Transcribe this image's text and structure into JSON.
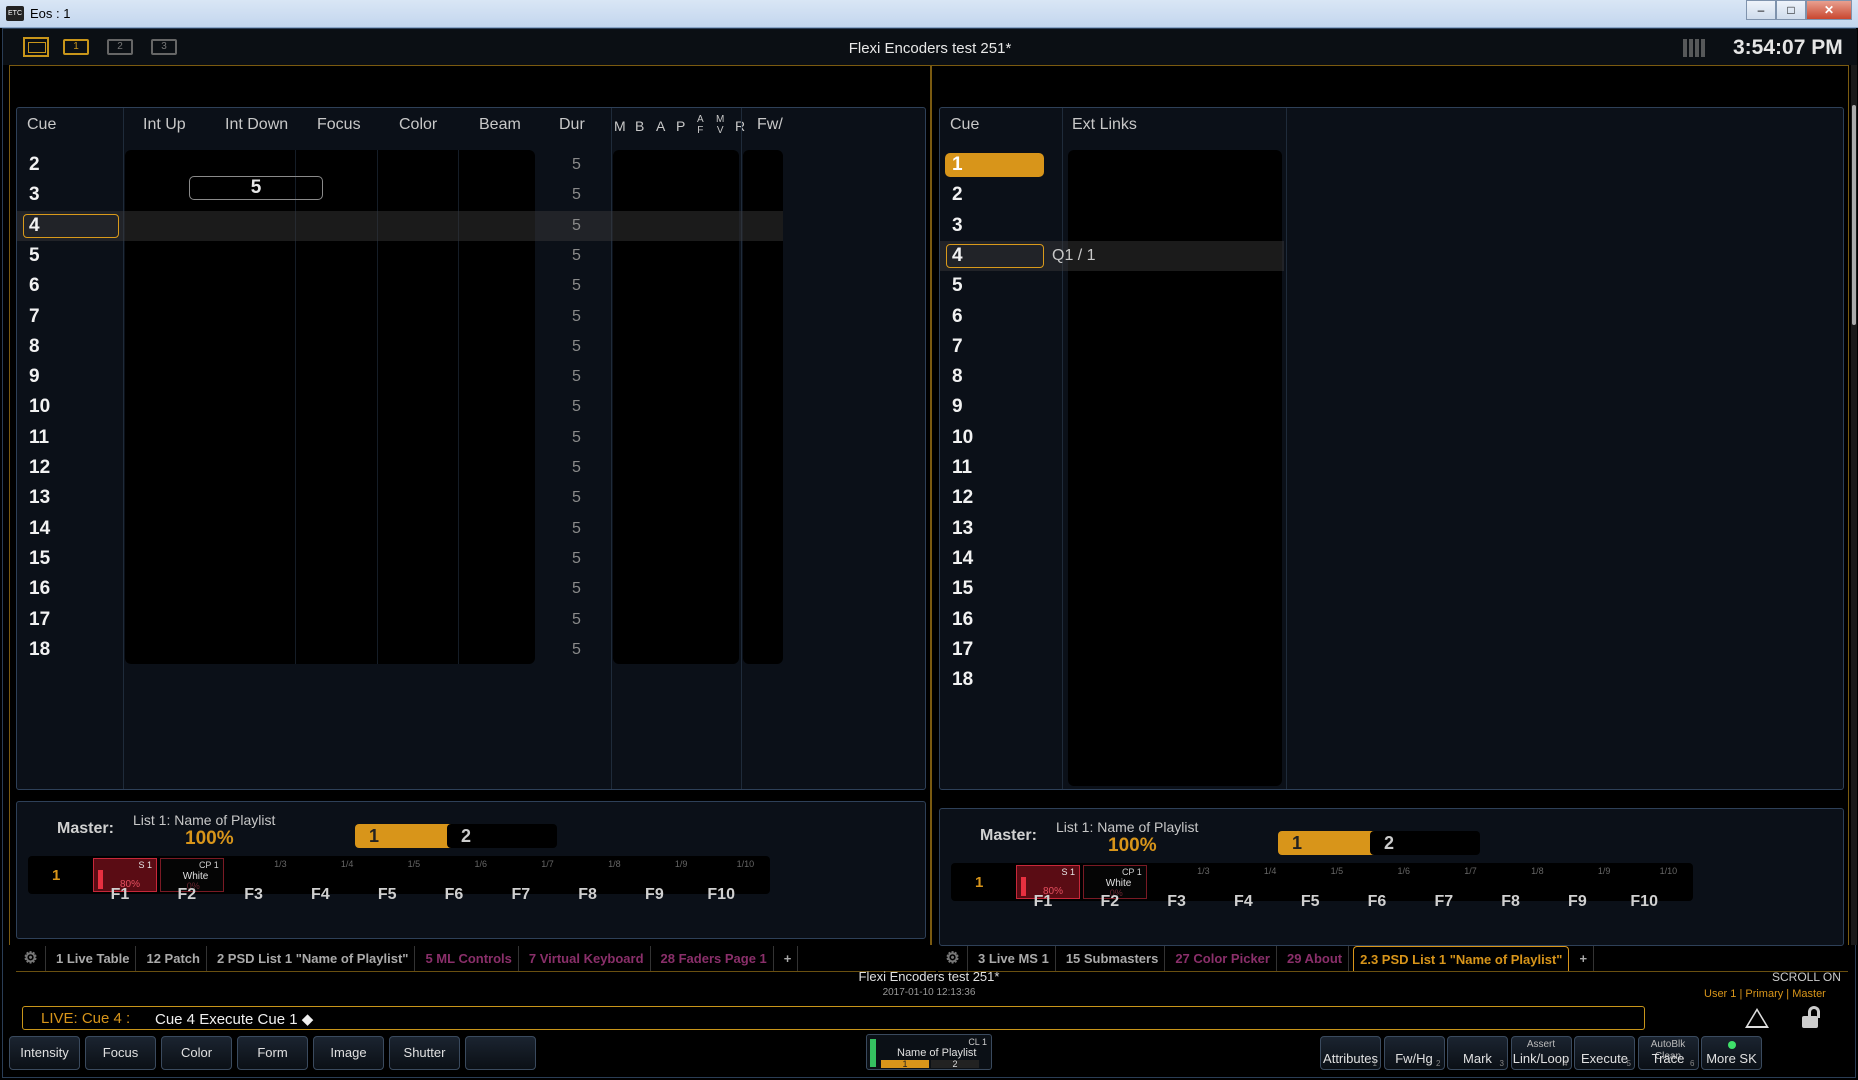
{
  "window": {
    "title": "Eos : 1",
    "icon_text": "ETC"
  },
  "topbar": {
    "workspaces": [
      "1",
      "2",
      "3"
    ],
    "show_title": "Flexi Encoders test 251*",
    "clock": "3:54:07 PM"
  },
  "left_cuelist": {
    "headers": {
      "cue": "Cue",
      "int_up": "Int Up",
      "int_down": "Int Down",
      "focus": "Focus",
      "color": "Color",
      "beam": "Beam",
      "dur": "Dur",
      "m": "M",
      "b": "B",
      "a": "A",
      "p": "P",
      "af_a": "A",
      "af_f": "F",
      "mv_m": "M",
      "mv_v": "V",
      "r": "R",
      "fw": "Fw/"
    },
    "int_up_value": "5",
    "selected_cue": "4",
    "rows": [
      {
        "cue": "2",
        "dur": "5"
      },
      {
        "cue": "3",
        "dur": "5"
      },
      {
        "cue": "4",
        "dur": "5"
      },
      {
        "cue": "5",
        "dur": "5"
      },
      {
        "cue": "6",
        "dur": "5"
      },
      {
        "cue": "7",
        "dur": "5"
      },
      {
        "cue": "8",
        "dur": "5"
      },
      {
        "cue": "9",
        "dur": "5"
      },
      {
        "cue": "10",
        "dur": "5"
      },
      {
        "cue": "11",
        "dur": "5"
      },
      {
        "cue": "12",
        "dur": "5"
      },
      {
        "cue": "13",
        "dur": "5"
      },
      {
        "cue": "14",
        "dur": "5"
      },
      {
        "cue": "15",
        "dur": "5"
      },
      {
        "cue": "16",
        "dur": "5"
      },
      {
        "cue": "17",
        "dur": "5"
      },
      {
        "cue": "18",
        "dur": "5"
      }
    ]
  },
  "right_cuelist": {
    "headers": {
      "cue": "Cue",
      "ext_links": "Ext Links"
    },
    "active_cue": "1",
    "selected_cue": "4",
    "rows": [
      {
        "cue": "1",
        "ext": ""
      },
      {
        "cue": "2",
        "ext": ""
      },
      {
        "cue": "3",
        "ext": ""
      },
      {
        "cue": "4",
        "ext": "Q1 / 1"
      },
      {
        "cue": "5",
        "ext": ""
      },
      {
        "cue": "6",
        "ext": ""
      },
      {
        "cue": "7",
        "ext": ""
      },
      {
        "cue": "8",
        "ext": ""
      },
      {
        "cue": "9",
        "ext": ""
      },
      {
        "cue": "10",
        "ext": ""
      },
      {
        "cue": "11",
        "ext": ""
      },
      {
        "cue": "12",
        "ext": ""
      },
      {
        "cue": "13",
        "ext": ""
      },
      {
        "cue": "14",
        "ext": ""
      },
      {
        "cue": "15",
        "ext": ""
      },
      {
        "cue": "16",
        "ext": ""
      },
      {
        "cue": "17",
        "ext": ""
      },
      {
        "cue": "18",
        "ext": ""
      }
    ]
  },
  "fader_panel": {
    "master_label": "Master:",
    "list_name": "List 1: Name of Playlist",
    "percent": "100%",
    "pages": [
      "1",
      "2"
    ],
    "current_page": "1",
    "slots": [
      {
        "label": "S 1",
        "main": "",
        "value": "80%",
        "level": 0.8
      },
      {
        "label": "CP 1",
        "main": "White",
        "value": "0%"
      },
      {
        "label": "1/3"
      },
      {
        "label": "1/4"
      },
      {
        "label": "1/5"
      },
      {
        "label": "1/6"
      },
      {
        "label": "1/7"
      },
      {
        "label": "1/8"
      },
      {
        "label": "1/9"
      },
      {
        "label": "1/10"
      }
    ],
    "fkeys": [
      "F1",
      "F2",
      "F3",
      "F4",
      "F5",
      "F6",
      "F7",
      "F8",
      "F9",
      "F10"
    ]
  },
  "tabs_left": [
    {
      "label": "1 Live Table",
      "style": "normal"
    },
    {
      "label": "12 Patch",
      "style": "normal"
    },
    {
      "label": "2 PSD List 1 \"Name of Playlist\"",
      "style": "normal"
    },
    {
      "label": "5 ML Controls",
      "style": "purple"
    },
    {
      "label": "7 Virtual Keyboard",
      "style": "purple"
    },
    {
      "label": "28 Faders Page 1",
      "style": "purple"
    },
    {
      "label": "+",
      "style": "normal"
    }
  ],
  "tabs_right": [
    {
      "label": "3 Live MS 1",
      "style": "normal"
    },
    {
      "label": "15 Submasters",
      "style": "normal"
    },
    {
      "label": "27 Color Picker",
      "style": "purple"
    },
    {
      "label": "29 About",
      "style": "purple"
    },
    {
      "label": "2.3 PSD List 1 \"Name of Playlist\"",
      "style": "active"
    },
    {
      "label": "+",
      "style": "normal"
    }
  ],
  "status": {
    "show_title": "Flexi Encoders test 251*",
    "date": "2017-01-10 12:13:36",
    "scroll_on": "SCROLL ON",
    "user_line": "User 1 | Primary | Master"
  },
  "command_line": {
    "mode": "LIVE: Cue  4 :",
    "command": "Cue 4 Execute Cue 1 ◆"
  },
  "softkeys_left": [
    "Intensity",
    "Focus",
    "Color",
    "Form",
    "Image",
    "Shutter",
    ""
  ],
  "playback": {
    "cl": "CL 1",
    "name": "Name of Playlist",
    "p1": "1",
    "p2": "2"
  },
  "softkeys_right": [
    {
      "sub": "",
      "label": "Attributes",
      "num": "1"
    },
    {
      "sub": "",
      "label": "Fw/Hg",
      "num": "2"
    },
    {
      "sub": "",
      "label": "Mark",
      "num": "3"
    },
    {
      "sub": "Assert",
      "label": "Link/Loop",
      "num": "4"
    },
    {
      "sub": "",
      "label": "Execute",
      "num": "5"
    },
    {
      "sub": "AutoBlk Clean",
      "label": "Trace",
      "num": "6"
    },
    {
      "sub": "",
      "label": "More SK",
      "num": ""
    }
  ],
  "colors": {
    "accent": "#d8951a",
    "fader_red": "#c8283a",
    "purple_tab": "#8a2f6a",
    "status_green": "#3fe06a"
  }
}
